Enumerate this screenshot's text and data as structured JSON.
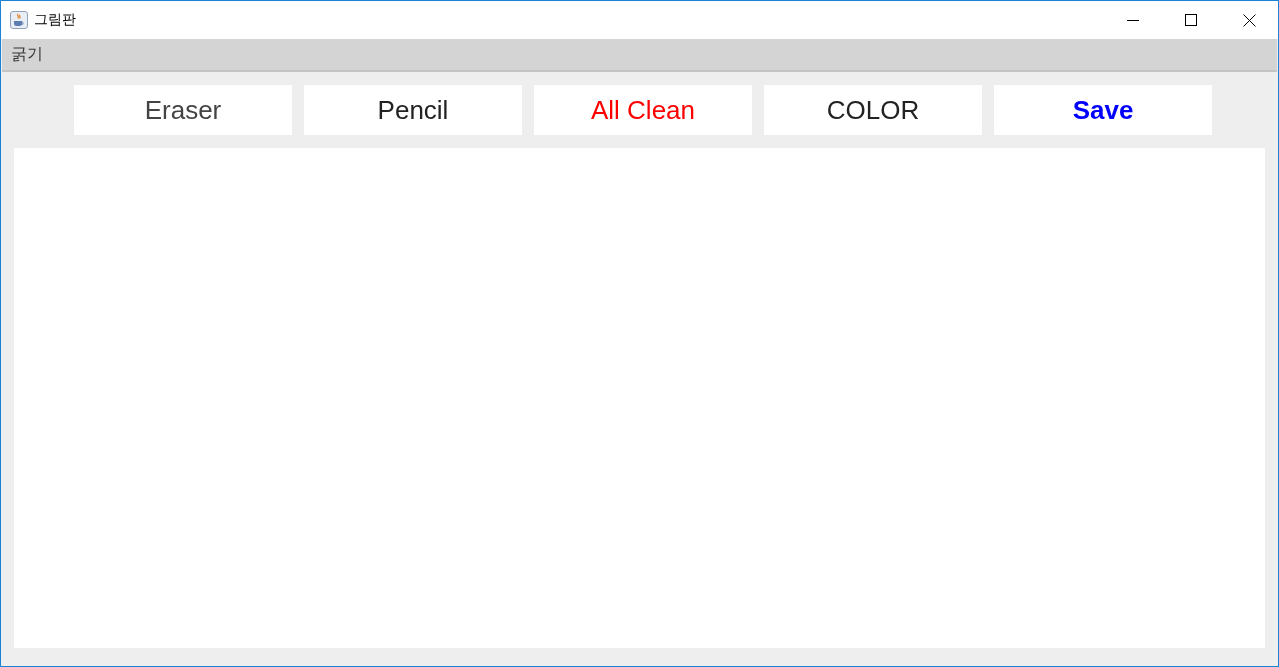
{
  "window": {
    "title": "그림판"
  },
  "menu_bar": {
    "items": [
      {
        "label": "굵기"
      }
    ]
  },
  "toolbar": {
    "buttons": [
      {
        "label": "Eraser",
        "color": "#444444",
        "bold": false
      },
      {
        "label": "Pencil",
        "color": "#222222",
        "bold": false
      },
      {
        "label": "All Clean",
        "color": "#ff0000",
        "bold": false
      },
      {
        "label": "COLOR",
        "color": "#222222",
        "bold": false
      },
      {
        "label": "Save",
        "color": "#0000ff",
        "bold": true
      }
    ]
  }
}
